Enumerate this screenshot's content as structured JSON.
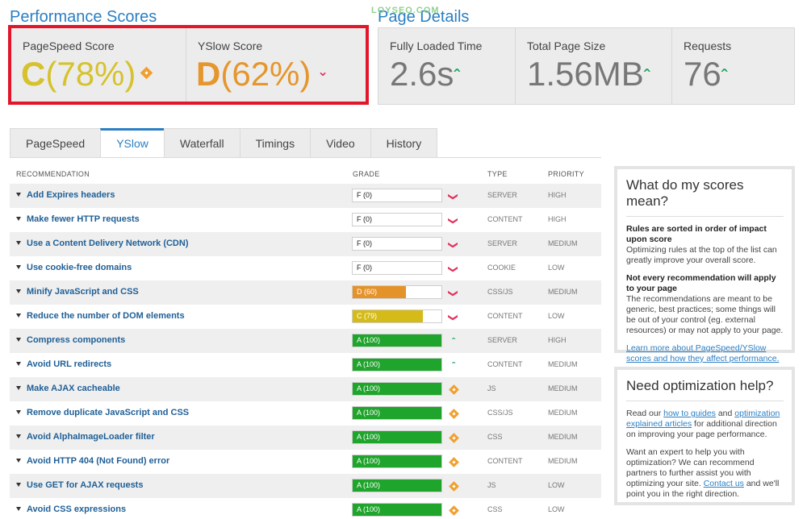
{
  "header": {
    "performance_title": "Performance Scores",
    "details_title": "Page Details",
    "watermark": "LOYSEO.COM"
  },
  "scores": {
    "pagespeed": {
      "label": "PageSpeed Score",
      "letter": "C",
      "percent": "(78%)",
      "trend": "neutral"
    },
    "yslow": {
      "label": "YSlow Score",
      "letter": "D",
      "percent": "(62%)",
      "trend": "down"
    }
  },
  "details": {
    "loaded": {
      "label": "Fully Loaded Time",
      "value": "2.6s"
    },
    "size": {
      "label": "Total Page Size",
      "value": "1.56MB"
    },
    "requests": {
      "label": "Requests",
      "value": "76"
    }
  },
  "tabs": [
    {
      "label": "PageSpeed",
      "active": false
    },
    {
      "label": "YSlow",
      "active": true
    },
    {
      "label": "Waterfall",
      "active": false
    },
    {
      "label": "Timings",
      "active": false
    },
    {
      "label": "Video",
      "active": false
    },
    {
      "label": "History",
      "active": false
    }
  ],
  "table": {
    "headers": {
      "recommendation": "RECOMMENDATION",
      "grade": "GRADE",
      "type": "TYPE",
      "priority": "PRIORITY"
    },
    "rows": [
      {
        "name": "Add Expires headers",
        "grade": "F (0)",
        "score": 0,
        "letter": "f",
        "trend": "down",
        "type": "SERVER",
        "priority": "HIGH"
      },
      {
        "name": "Make fewer HTTP requests",
        "grade": "F (0)",
        "score": 0,
        "letter": "f",
        "trend": "down",
        "type": "CONTENT",
        "priority": "HIGH"
      },
      {
        "name": "Use a Content Delivery Network (CDN)",
        "grade": "F (0)",
        "score": 0,
        "letter": "f",
        "trend": "down",
        "type": "SERVER",
        "priority": "MEDIUM"
      },
      {
        "name": "Use cookie-free domains",
        "grade": "F (0)",
        "score": 0,
        "letter": "f",
        "trend": "down",
        "type": "COOKIE",
        "priority": "LOW"
      },
      {
        "name": "Minify JavaScript and CSS",
        "grade": "D (60)",
        "score": 60,
        "letter": "d",
        "trend": "down",
        "type": "CSS/JS",
        "priority": "MEDIUM"
      },
      {
        "name": "Reduce the number of DOM elements",
        "grade": "C (79)",
        "score": 79,
        "letter": "c",
        "trend": "down",
        "type": "CONTENT",
        "priority": "LOW"
      },
      {
        "name": "Compress components",
        "grade": "A (100)",
        "score": 100,
        "letter": "a",
        "trend": "up",
        "type": "SERVER",
        "priority": "HIGH"
      },
      {
        "name": "Avoid URL redirects",
        "grade": "A (100)",
        "score": 100,
        "letter": "a",
        "trend": "up",
        "type": "CONTENT",
        "priority": "MEDIUM"
      },
      {
        "name": "Make AJAX cacheable",
        "grade": "A (100)",
        "score": 100,
        "letter": "a",
        "trend": "neutral",
        "type": "JS",
        "priority": "MEDIUM"
      },
      {
        "name": "Remove duplicate JavaScript and CSS",
        "grade": "A (100)",
        "score": 100,
        "letter": "a",
        "trend": "neutral",
        "type": "CSS/JS",
        "priority": "MEDIUM"
      },
      {
        "name": "Avoid AlphaImageLoader filter",
        "grade": "A (100)",
        "score": 100,
        "letter": "a",
        "trend": "neutral",
        "type": "CSS",
        "priority": "MEDIUM"
      },
      {
        "name": "Avoid HTTP 404 (Not Found) error",
        "grade": "A (100)",
        "score": 100,
        "letter": "a",
        "trend": "neutral",
        "type": "CONTENT",
        "priority": "MEDIUM"
      },
      {
        "name": "Use GET for AJAX requests",
        "grade": "A (100)",
        "score": 100,
        "letter": "a",
        "trend": "neutral",
        "type": "JS",
        "priority": "LOW"
      },
      {
        "name": "Avoid CSS expressions",
        "grade": "A (100)",
        "score": 100,
        "letter": "a",
        "trend": "neutral",
        "type": "CSS",
        "priority": "LOW"
      }
    ]
  },
  "colors": {
    "a": "#1fa42c",
    "c": "#d4bb18",
    "d": "#e4932a",
    "f": "#ffffff",
    "accent": "#2a7fc4",
    "highlight": "#e2162b"
  },
  "panel_scores": {
    "title": "What do my scores mean?",
    "p1_bold": "Rules are sorted in order of impact upon score",
    "p1_text": "Optimizing rules at the top of the list can greatly improve your overall score.",
    "p2_bold": "Not every recommendation will apply to your page",
    "p2_text": "The recommendations are meant to be generic, best practices; some things will be out of your control (eg. external resources) or may not apply to your page.",
    "link": "Learn more about PageSpeed/YSlow scores and how they affect performance."
  },
  "panel_help": {
    "title": "Need optimization help?",
    "p1_a": "Read our ",
    "link_guides": "how to guides",
    "p1_b": " and ",
    "link_articles": "optimization explained articles",
    "p1_c": " for additional direction on improving your page performance.",
    "p2_a": "Want an expert to help you with optimization? We can recommend partners to further assist you with optimizing your site. ",
    "link_contact": "Contact us",
    "p2_b": " and we'll point you in the right direction."
  }
}
